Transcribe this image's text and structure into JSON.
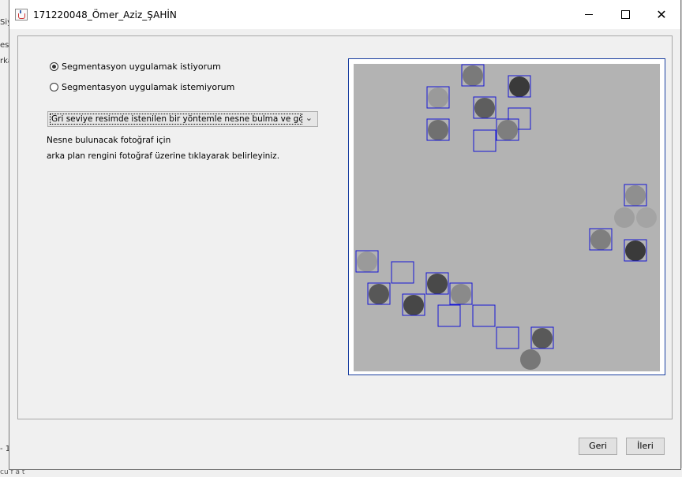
{
  "background": {
    "left_fragments": [
      "Siy",
      "es",
      "rka",
      "- 1"
    ],
    "bottom_fragment": "cu                 f        a   t"
  },
  "window": {
    "title": "171220048_Ömer_Aziz_ŞAHİN",
    "controls": {
      "minimize": "—",
      "maximize": "☐",
      "close": "✕"
    }
  },
  "segmentation": {
    "options": [
      {
        "label": "Segmentasyon uygulamak istiyorum",
        "selected": true
      },
      {
        "label": "Segmentasyon uygulamak istemiyorum",
        "selected": false
      }
    ]
  },
  "method_select": {
    "value": "Gri seviye resimde istenilen bir yöntemle nesne bulma ve gösterme"
  },
  "instructions": {
    "line1": "Nesne bulunacak fotoğraf için",
    "line2": "arka plan rengini fotoğraf üzerine tıklayarak belirleyiniz."
  },
  "footer": {
    "back_label": "Geri",
    "next_label": "İleri"
  },
  "image": {
    "background_color": "#b3b3b3",
    "box_color": "#1414d6",
    "objects": [
      {
        "shade": "#7a7a7a",
        "boxed": true
      },
      {
        "shade": "#3a3a3a",
        "boxed": true
      },
      {
        "shade": "#9a9a9a",
        "boxed": true
      },
      {
        "shade": "#5e5e5e",
        "boxed": true
      },
      {
        "shade": "#707070",
        "boxed": true
      },
      {
        "shade": "#b3b3b3",
        "boxed": true
      },
      {
        "shade": "#7e7e7e",
        "boxed": true
      },
      {
        "shade": "#b3b3b3",
        "boxed": true
      },
      {
        "shade": "#8f8f8f",
        "boxed": true
      },
      {
        "shade": "#9f9f9f",
        "boxed": false
      },
      {
        "shade": "#a4a4a4",
        "boxed": false
      },
      {
        "shade": "#7f7f7f",
        "boxed": true
      },
      {
        "shade": "#3a3a3a",
        "boxed": true
      },
      {
        "shade": "#9a9a9a",
        "boxed": true
      },
      {
        "shade": "#b3b3b3",
        "boxed": true
      },
      {
        "shade": "#494949",
        "boxed": true
      },
      {
        "shade": "#575757",
        "boxed": true
      },
      {
        "shade": "#474747",
        "boxed": true
      },
      {
        "shade": "#8a8a8a",
        "boxed": true
      },
      {
        "shade": "#b3b3b3",
        "boxed": true
      },
      {
        "shade": "#b3b3b3",
        "boxed": true
      },
      {
        "shade": "#b3b3b3",
        "boxed": true
      },
      {
        "shade": "#595959",
        "boxed": true
      },
      {
        "shade": "#777777",
        "boxed": false
      }
    ]
  }
}
